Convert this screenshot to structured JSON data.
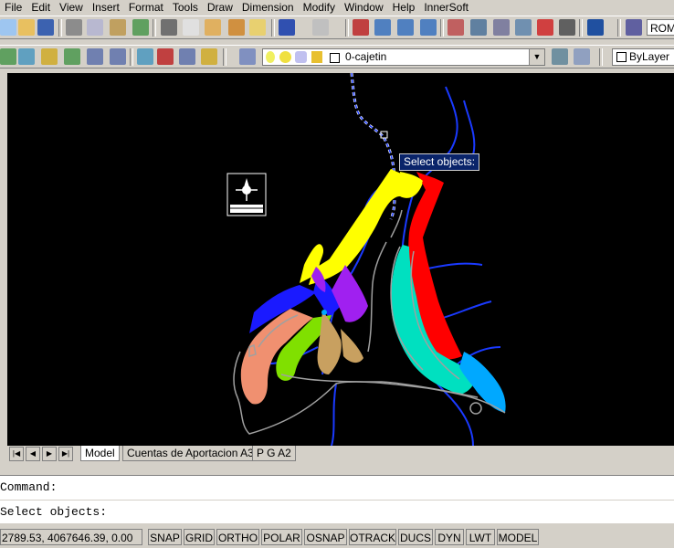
{
  "menu": [
    "File",
    "Edit",
    "View",
    "Insert",
    "Format",
    "Tools",
    "Draw",
    "Dimension",
    "Modify",
    "Window",
    "Help",
    "InnerSoft"
  ],
  "toolbar": {
    "font_style": "ROM",
    "layer": "0-cajetin",
    "linetype": "ByLayer"
  },
  "tooltip": "Select objects:",
  "tabs": {
    "nav_first": "|◀",
    "nav_prev": "◀",
    "nav_next": "▶",
    "nav_last": "▶|",
    "items": [
      "Model",
      "Cuentas de Aportacion A3",
      "P G A2"
    ]
  },
  "command": {
    "line1": "Command:",
    "line2": "Select objects:"
  },
  "status": {
    "coords": "2789.53, 4067646.39, 0.00",
    "buttons": [
      "SNAP",
      "GRID",
      "ORTHO",
      "POLAR",
      "OSNAP",
      "OTRACK",
      "DUCS",
      "DYN",
      "LWT",
      "MODEL"
    ]
  },
  "colors": {
    "drawing_bg": "#000000",
    "yellow": "#ffff00",
    "red": "#ff0000",
    "cyan": "#00e0c0",
    "blue": "#1a1aff",
    "salmon": "#f09070",
    "green": "#80e000",
    "magenta": "#a020f0",
    "tan": "#c8a060",
    "light_blue": "#00a8ff"
  }
}
